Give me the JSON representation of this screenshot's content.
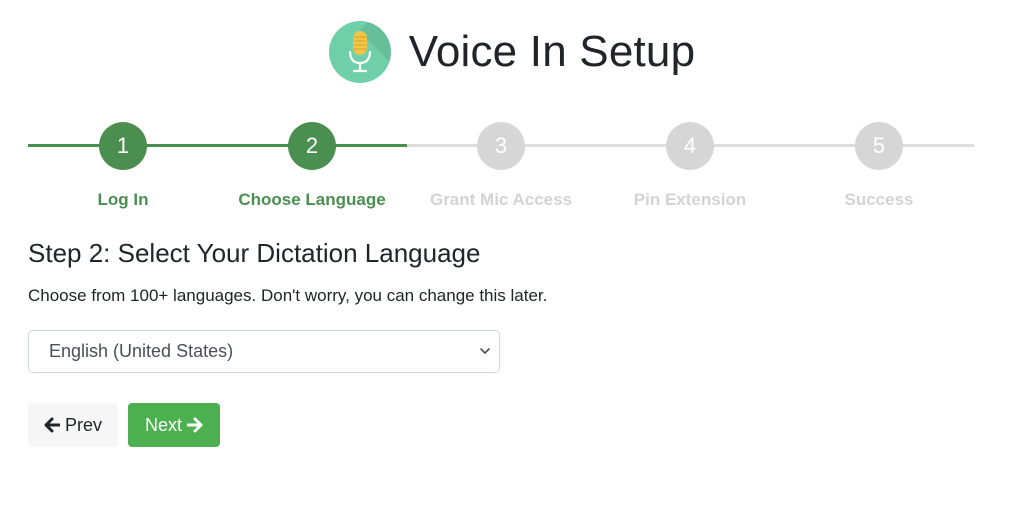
{
  "header": {
    "title": "Voice In Setup",
    "logo_icon": "microphone-icon",
    "logo_color": "#6fcfa8"
  },
  "stepper": {
    "current_step": 2,
    "steps": [
      {
        "number": "1",
        "label": "Log In",
        "state": "completed"
      },
      {
        "number": "2",
        "label": "Choose Language",
        "state": "current"
      },
      {
        "number": "3",
        "label": "Grant Mic Access",
        "state": "upcoming"
      },
      {
        "number": "4",
        "label": "Pin Extension",
        "state": "upcoming"
      },
      {
        "number": "5",
        "label": "Success",
        "state": "upcoming"
      }
    ],
    "active_color": "#4a8f50",
    "inactive_color": "#d6d6d6"
  },
  "content": {
    "heading": "Step 2: Select Your Dictation Language",
    "description": "Choose from 100+ languages. Don't worry, you can change this later.",
    "language_select": {
      "selected": "English (United States)",
      "icon": "chevron-down-icon"
    }
  },
  "buttons": {
    "prev_label": "Prev",
    "prev_icon": "arrow-left-icon",
    "next_label": "Next",
    "next_icon": "arrow-right-icon",
    "next_color": "#4caf50"
  }
}
